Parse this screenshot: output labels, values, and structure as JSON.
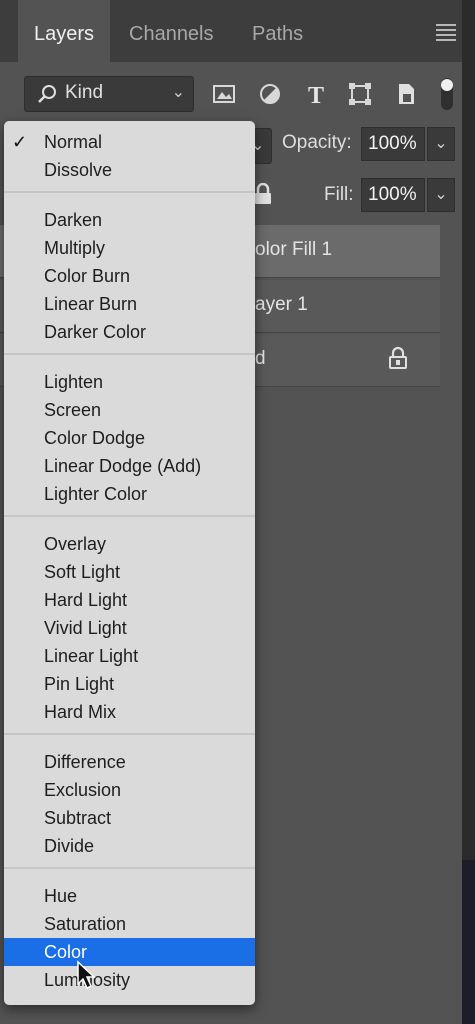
{
  "tabs": [
    {
      "label": "Layers",
      "active": true
    },
    {
      "label": "Channels",
      "active": false
    },
    {
      "label": "Paths",
      "active": false
    }
  ],
  "filter": {
    "kind_label": "Kind",
    "icons": [
      "image-filter-icon",
      "adjustment-filter-icon",
      "type-filter-icon",
      "shape-filter-icon",
      "smart-object-filter-icon",
      "filter-toggle-icon"
    ]
  },
  "opacity": {
    "label": "Opacity:",
    "value": "100%"
  },
  "fill": {
    "label": "Fill:",
    "value": "100%"
  },
  "layers": [
    {
      "name": "olor Fill 1",
      "selected": true
    },
    {
      "name": "ayer 1",
      "selected": false
    },
    {
      "name": "d",
      "selected": false,
      "locked": true
    }
  ],
  "blend_menu": {
    "groups": [
      [
        "Normal",
        "Dissolve"
      ],
      [
        "Darken",
        "Multiply",
        "Color Burn",
        "Linear Burn",
        "Darker Color"
      ],
      [
        "Lighten",
        "Screen",
        "Color Dodge",
        "Linear Dodge (Add)",
        "Lighter Color"
      ],
      [
        "Overlay",
        "Soft Light",
        "Hard Light",
        "Vivid Light",
        "Linear Light",
        "Pin Light",
        "Hard Mix"
      ],
      [
        "Difference",
        "Exclusion",
        "Subtract",
        "Divide"
      ],
      [
        "Hue",
        "Saturation",
        "Color",
        "Luminosity"
      ]
    ],
    "checked": "Normal",
    "highlighted": "Color",
    "check_glyph": "✓"
  },
  "colors": {
    "panel_bg": "#535353",
    "menu_bg": "#dadada",
    "highlight": "#1a6ee6"
  }
}
